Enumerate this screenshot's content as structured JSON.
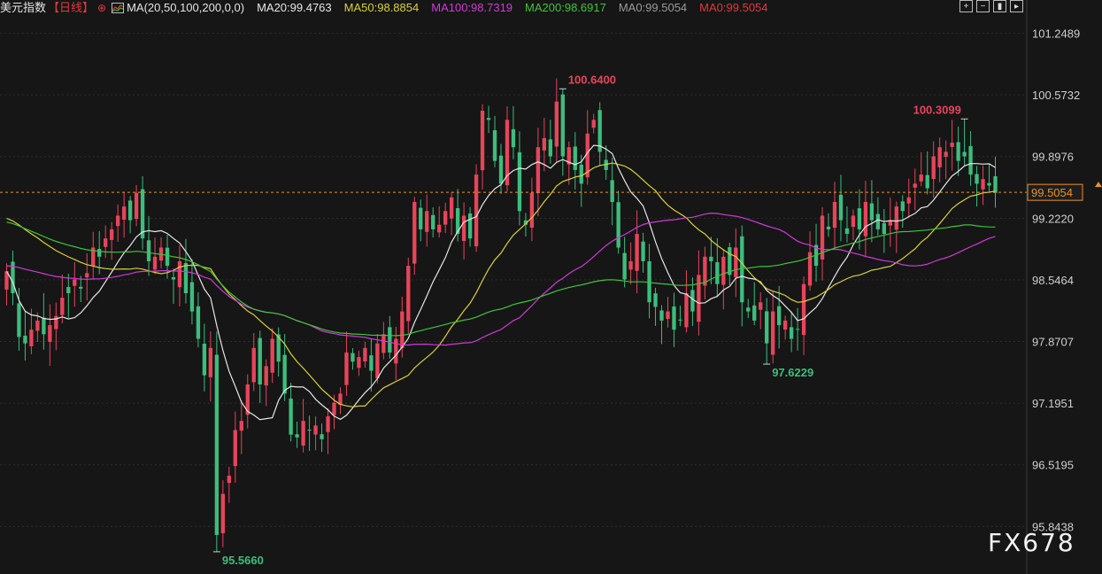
{
  "legend": {
    "symbol": "美元指数",
    "period": "【日线】",
    "target_icon": "⊕",
    "ma_params": "MA(20,50,100,200,0,0)",
    "items": [
      {
        "label": "MA20:99.4763",
        "color": "#e6e6e6"
      },
      {
        "label": "MA50:98.8854",
        "color": "#d8d13a"
      },
      {
        "label": "MA100:98.7319",
        "color": "#d13ad6"
      },
      {
        "label": "MA200:98.6917",
        "color": "#3ec43e"
      },
      {
        "label": "MA0:99.5054",
        "color": "#9a9a9a"
      },
      {
        "label": "MA0:99.5054",
        "color": "#e0393e"
      }
    ]
  },
  "toolbar": {
    "icons": [
      "plus-grid-icon",
      "minus-grid-icon",
      "candle-view-icon",
      "expand-icon"
    ]
  },
  "watermark": "FX678",
  "colors": {
    "up": "#e6455a",
    "down": "#3dbd7d",
    "background": "#161616",
    "grid": "#2e2e2e",
    "current": "#e8932c"
  },
  "chart_data": {
    "type": "candlestick",
    "y_ticks": [
      "101.2489",
      "100.5732",
      "99.8976",
      "99.2220",
      "98.5464",
      "97.8707",
      "97.1951",
      "96.5195",
      "95.8438"
    ],
    "ylim": [
      95.4,
      101.4
    ],
    "current_price": "99.5054",
    "current_value": 99.5054,
    "annotations": [
      {
        "label": "100.6400",
        "value": 100.64,
        "index": 90,
        "color": "#e6455a",
        "side": "right"
      },
      {
        "label": "95.5660",
        "value": 95.566,
        "index": 34,
        "color": "#3dbd7d",
        "side": "right"
      },
      {
        "label": "97.6229",
        "value": 97.6229,
        "index": 123,
        "color": "#3dbd7d",
        "side": "right"
      },
      {
        "label": "100.3099",
        "value": 100.3099,
        "index": 155,
        "color": "#e6455a",
        "side": "left"
      }
    ],
    "closes": [
      98.64,
      98.4,
      97.92,
      97.85,
      98.0,
      98.1,
      97.95,
      98.05,
      98.15,
      98.35,
      98.4,
      98.55,
      98.45,
      98.62,
      98.9,
      98.8,
      99.0,
      99.1,
      99.25,
      99.35,
      99.2,
      99.5,
      99.0,
      98.75,
      98.8,
      98.9,
      98.7,
      98.55,
      98.75,
      98.4,
      98.2,
      97.9,
      97.5,
      97.8,
      95.75,
      96.2,
      96.4,
      96.9,
      97.0,
      97.4,
      97.8,
      97.4,
      97.6,
      97.9,
      97.65,
      97.3,
      96.85,
      96.82,
      97.0,
      96.9,
      96.95,
      96.8,
      97.05,
      97.2,
      97.3,
      97.75,
      97.65,
      97.7,
      97.8,
      97.55,
      97.85,
      97.95,
      97.75,
      97.9,
      98.2,
      98.7,
      99.4,
      99.1,
      99.3,
      99.1,
      99.15,
      99.3,
      99.45,
      99.05,
      99.25,
      99.0,
      99.7,
      100.4,
      100.3,
      99.85,
      99.6,
      100.3,
      100.0,
      99.3,
      99.15,
      99.5,
      100.0,
      100.1,
      99.9,
      100.5,
      99.9,
      100.0,
      99.75,
      99.6,
      100.15,
      100.3,
      99.95,
      99.75,
      99.4,
      98.9,
      98.55,
      98.75,
      99.05,
      98.75,
      98.3,
      98.25,
      98.1,
      98.2,
      98.0,
      98.1,
      98.4,
      98.2,
      98.6,
      98.8,
      98.75,
      98.5,
      98.8,
      98.6,
      98.9,
      98.3,
      98.2,
      98.1,
      98.3,
      97.85,
      98.2,
      98.05,
      98.1,
      97.9,
      98.0,
      98.5,
      98.85,
      98.7,
      99.25,
      99.1,
      99.4,
      99.2,
      99.05,
      99.25,
      99.1,
      99.4,
      99.2,
      99.1,
      99.05,
      99.2,
      99.35,
      99.3,
      99.45,
      99.6,
      99.7,
      99.55,
      99.9,
      100.0,
      99.95,
      100.05,
      99.85,
      99.9,
      99.7,
      99.6,
      99.65,
      99.58,
      99.5
    ]
  }
}
